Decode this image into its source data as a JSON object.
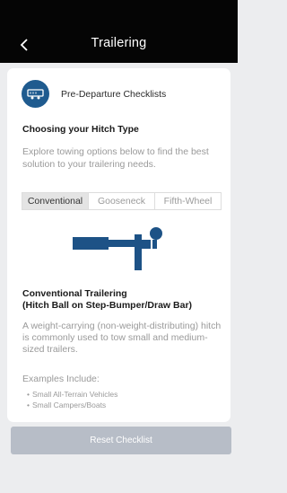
{
  "header": {
    "title": "Trailering",
    "back_icon": "chevron-left-icon"
  },
  "checklist": {
    "label": "Pre-Departure Checklists",
    "icon": "trailer-icon"
  },
  "section": {
    "heading": "Choosing your Hitch Type",
    "description": "Explore towing options below to find the best solution to your trailering needs."
  },
  "tabs": [
    {
      "label": "Conventional",
      "active": true
    },
    {
      "label": "Gooseneck",
      "active": false
    },
    {
      "label": "Fifth-Wheel",
      "active": false
    }
  ],
  "detail": {
    "heading_line1": "Conventional Trailering",
    "heading_line2": "(Hitch Ball on Step-Bumper/Draw Bar)",
    "description": "A weight-carrying (non-weight-distributing) hitch is commonly used to tow small and medium-sized trailers.",
    "examples_label": "Examples Include:",
    "examples": [
      "Small All-Terrain Vehicles",
      "Small Campers/Boats"
    ]
  },
  "footer": {
    "reset_label": "Reset Checklist"
  },
  "colors": {
    "header_bg": "#050505",
    "icon_bg": "#1f5b8f",
    "hitch_color": "#1d5286",
    "button_disabled": "#b7bdc7"
  }
}
